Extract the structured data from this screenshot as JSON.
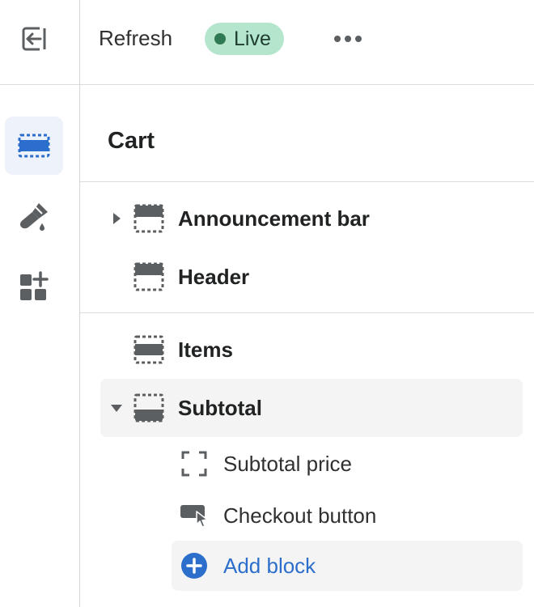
{
  "topbar": {
    "exit_icon": "exit-icon",
    "refresh_label": "Refresh",
    "status_label": "Live",
    "status_color": "#b4e6cd",
    "more_icon": "more-horizontal-icon"
  },
  "rail": {
    "items": [
      {
        "name": "sections",
        "icon": "layout-sections-icon",
        "active": true
      },
      {
        "name": "theme-settings",
        "icon": "paintbrush-icon",
        "active": false
      },
      {
        "name": "apps",
        "icon": "app-blocks-icon",
        "active": false
      }
    ]
  },
  "panel": {
    "title": "Cart",
    "header_group": [
      {
        "label": "Announcement bar",
        "icon": "section-top-icon",
        "collapsible": true,
        "expanded": false
      },
      {
        "label": "Header",
        "icon": "section-top-icon",
        "collapsible": false
      }
    ],
    "template_group": [
      {
        "label": "Items",
        "icon": "section-middle-icon",
        "collapsible": false
      },
      {
        "label": "Subtotal",
        "icon": "section-bottom-icon",
        "collapsible": true,
        "expanded": true,
        "selected": true,
        "blocks": [
          {
            "label": "Subtotal price",
            "icon": "frame-corners-icon"
          },
          {
            "label": "Checkout button",
            "icon": "button-cursor-icon"
          }
        ],
        "add_block_label": "Add block"
      }
    ]
  },
  "colors": {
    "accent": "#2c6ecb",
    "icon_dark": "#5c5f62",
    "selected_bg": "#f4f4f4",
    "active_rail_bg": "#eef2fb"
  }
}
